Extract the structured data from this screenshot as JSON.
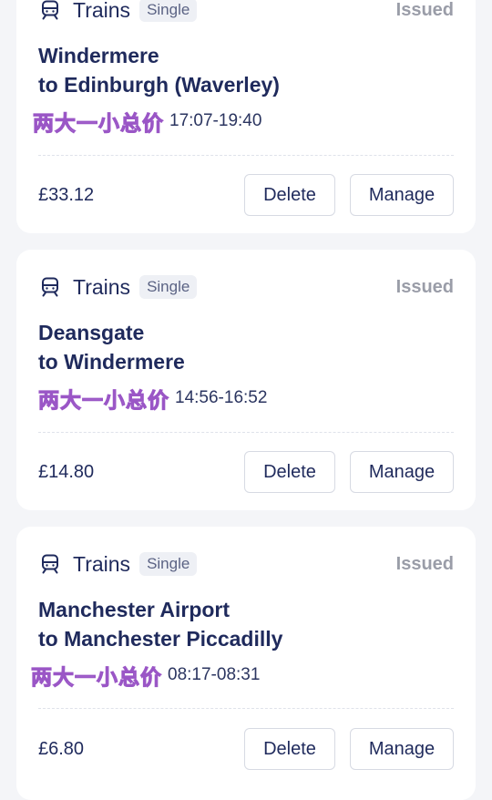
{
  "colors": {
    "background": "#f4f5f8",
    "card": "#ffffff",
    "text_primary": "#1f2a5c",
    "status_text": "#9a9da8",
    "badge_bg": "#eef0f5"
  },
  "bookings": [
    {
      "mode_icon": "train-icon",
      "mode": "Trains",
      "ticket_type": "Single",
      "status": "Issued",
      "origin_line": "Windermere",
      "destination_line": "to Edinburgh (Waverley)",
      "sticker_text": "两大一小总价",
      "time": "17:07-19:40",
      "price": "£33.12",
      "delete_label": "Delete",
      "manage_label": "Manage"
    },
    {
      "mode_icon": "train-icon",
      "mode": "Trains",
      "ticket_type": "Single",
      "status": "Issued",
      "origin_line": "Deansgate",
      "destination_line": "to Windermere",
      "sticker_text": "两大一小总价",
      "time": "14:56-16:52",
      "price": "£14.80",
      "delete_label": "Delete",
      "manage_label": "Manage"
    },
    {
      "mode_icon": "train-icon",
      "mode": "Trains",
      "ticket_type": "Single",
      "status": "Issued",
      "origin_line": "Manchester Airport",
      "destination_line": "to Manchester Piccadilly",
      "sticker_text": "两大一小总价",
      "time": "08:17-08:31",
      "price": "£6.80",
      "delete_label": "Delete",
      "manage_label": "Manage"
    }
  ]
}
